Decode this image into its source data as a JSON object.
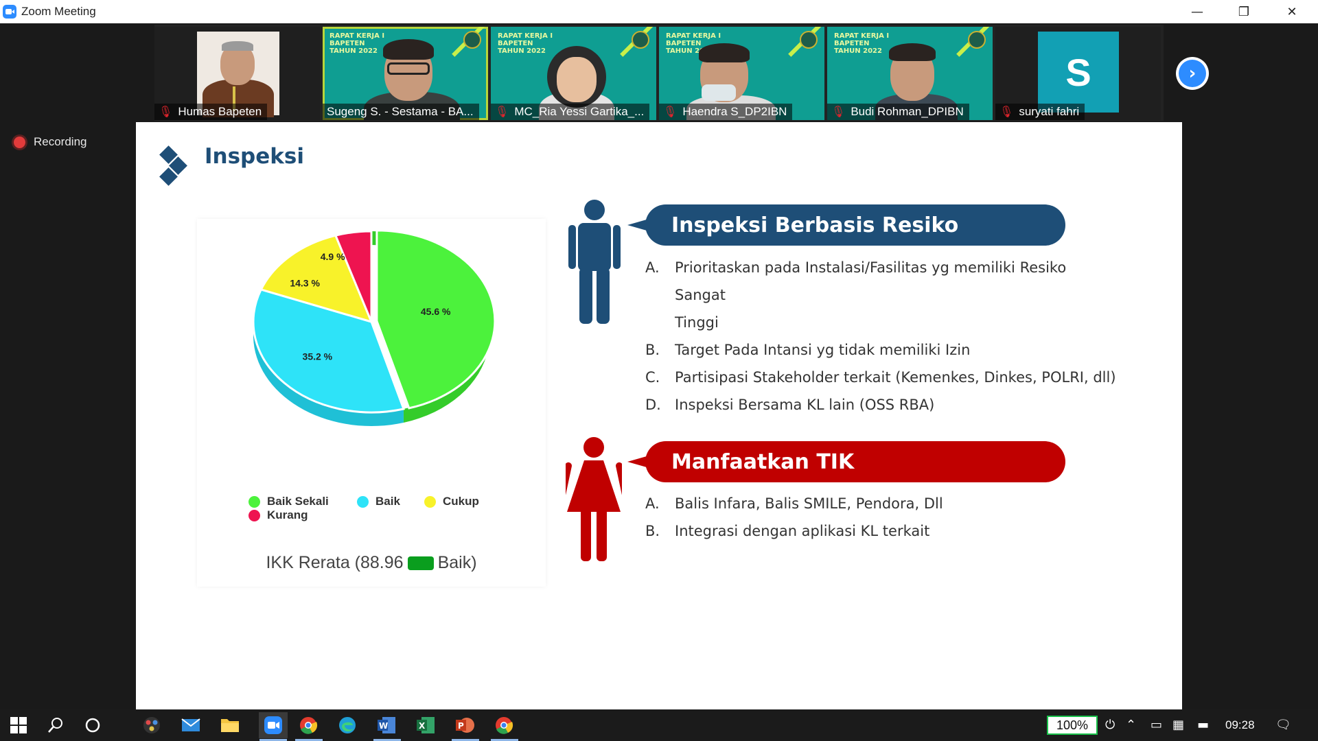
{
  "window": {
    "title": "Zoom Meeting",
    "minimize": "—",
    "restore": "❐",
    "close": "✕"
  },
  "participants": [
    {
      "name": "Humas Bapeten",
      "muted": true,
      "type": "photo"
    },
    {
      "name": "Sugeng S. - Sestama - BA...",
      "muted": false,
      "type": "banner",
      "active": true
    },
    {
      "name": "MC_Ria Yessi Gartika_...",
      "muted": true,
      "type": "banner"
    },
    {
      "name": "Haendra S_DP2IBN",
      "muted": true,
      "type": "banner"
    },
    {
      "name": "Budi Rohman_DPIBN",
      "muted": true,
      "type": "banner"
    },
    {
      "name": "suryati fahri",
      "muted": true,
      "type": "avatar",
      "initial": "S"
    }
  ],
  "banner_text": "RAPAT KERJA I BAPETEN TAHUN 2022",
  "recording_label": "Recording",
  "slide": {
    "title": "Inspeksi",
    "section1": {
      "heading": "Inspeksi Berbasis Resiko",
      "color": "#1e4e77",
      "items": [
        {
          "letter": "A.",
          "text": "Prioritaskan pada Instalasi/Fasilitas yg memiliki Resiko Sangat"
        },
        {
          "letter": "",
          "text": "Tinggi"
        },
        {
          "letter": "B.",
          "text": "Target Pada Intansi yg tidak memiliki Izin"
        },
        {
          "letter": "C.",
          "text": "Partisipasi Stakeholder terkait (Kemenkes, Dinkes, POLRI, dll)"
        },
        {
          "letter": "D.",
          "text": "Inspeksi Bersama KL lain (OSS RBA)"
        }
      ]
    },
    "section2": {
      "heading": "Manfaatkan TIK",
      "color": "#c00000",
      "items": [
        {
          "letter": "A.",
          "text": "Balis Infara, Balis SMILE, Pendora, Dll"
        },
        {
          "letter": "B.",
          "text": "Integrasi dengan aplikasi KL terkait"
        }
      ]
    },
    "ikk": {
      "prefix": "IKK Rerata (88.96",
      "suffix": "Baik)"
    }
  },
  "chart_data": {
    "type": "pie",
    "title": "",
    "series": [
      {
        "name": "Baik Sekali",
        "value": 45.6,
        "label": "45.6 %",
        "color": "#4cf23c",
        "side": "#34cc2a"
      },
      {
        "name": "Baik",
        "value": 35.2,
        "label": "35.2 %",
        "color": "#2ee3f8",
        "side": "#1fc0d6"
      },
      {
        "name": "Cukup",
        "value": 14.3,
        "label": "14.3 %",
        "color": "#f8f22a",
        "side": "#d4cf10"
      },
      {
        "name": "Kurang",
        "value": 4.9,
        "label": "4.9 %",
        "color": "#ee1450",
        "side": "#c00e3e"
      }
    ],
    "legend": "bottom"
  },
  "taskbar": {
    "battery_level": "100%",
    "clock": "09:28"
  }
}
